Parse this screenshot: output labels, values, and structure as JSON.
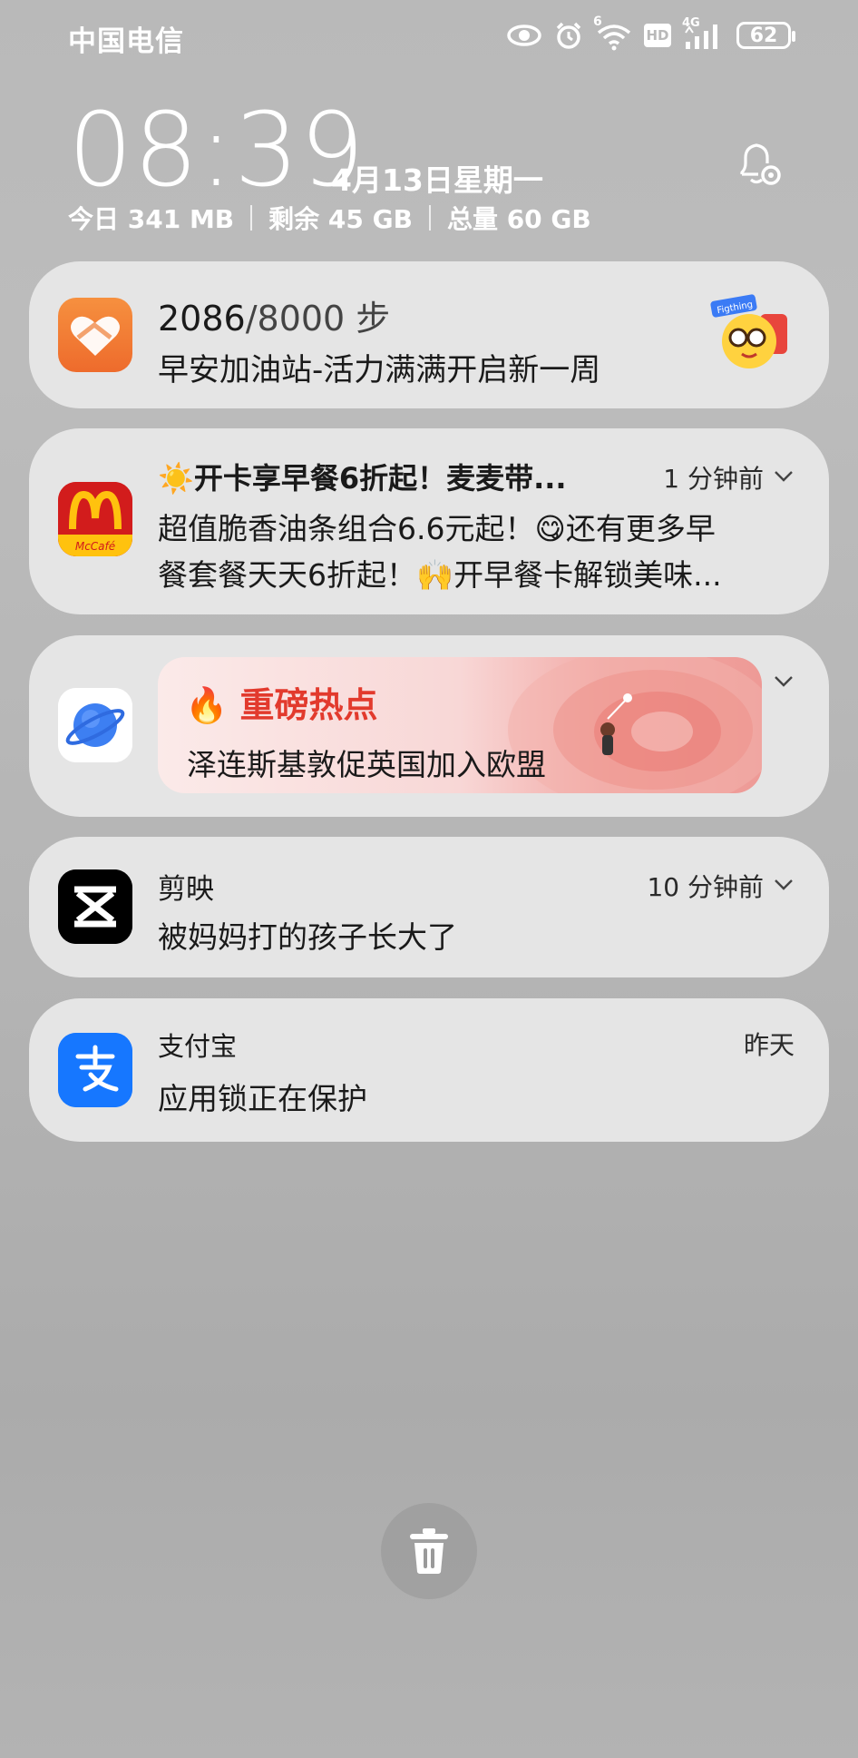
{
  "status_bar": {
    "carrier": "中国电信",
    "network_label": "4G",
    "hd_label": "HD",
    "wifi_superscript": "6",
    "battery": "62"
  },
  "lockscreen": {
    "time": "08:39",
    "date": "4月13日星期一",
    "data_today": "今日 341 MB",
    "storage_free": "剩余 45 GB",
    "storage_total": "总量 60 GB"
  },
  "notifications": [
    {
      "app": "health",
      "steps": "2086",
      "steps_total": "/8000 步",
      "body": "早安加油站-活力满满开启新一周",
      "mascot_label": "Figthing"
    },
    {
      "app": "mcdonalds",
      "icon_label": "McCafé",
      "title": "☀️开卡享早餐6折起！麦麦带...",
      "time": "1 分钟前",
      "body_line1": "超值脆香油条组合6.6元起！😋还有更多早",
      "body_line2": "餐套餐天天6折起！🙌开早餐卡解锁美味..."
    },
    {
      "app": "browser",
      "hot_label": "🔥 重磅热点",
      "headline": "泽连斯基敦促英国加入欧盟"
    },
    {
      "app": "剪映",
      "title": "剪映",
      "time": "10 分钟前",
      "body": "被妈妈打的孩子长大了"
    },
    {
      "app": "支付宝",
      "title": "支付宝",
      "time": "昨天",
      "body": "应用锁正在保护"
    }
  ],
  "colors": {
    "health_orange": "#f07a33",
    "mcd_red": "#d21c1c",
    "mcd_yellow": "#ffc20e",
    "alipay_blue": "#1677ff",
    "hot_red": "#e23a2d"
  }
}
